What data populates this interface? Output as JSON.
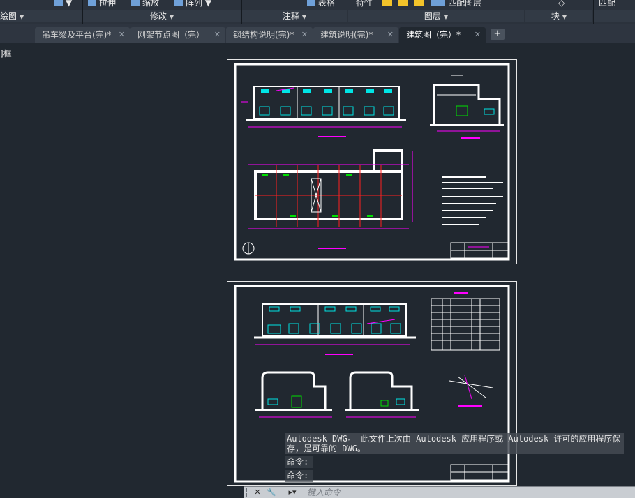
{
  "ribbon": {
    "top_items": [
      {
        "label": "▼",
        "icon": "dropdown-icon"
      },
      {
        "label": "拉伸",
        "icon": "stretch-icon"
      },
      {
        "label": "缩放",
        "icon": "scale-icon"
      },
      {
        "label": "阵列 ▼",
        "icon": "array-icon"
      },
      {
        "label": "表格",
        "icon": "table-icon"
      },
      {
        "label": "特性",
        "icon": "properties-icon"
      },
      {
        "label": "匹配图层",
        "icon": "match-layer-icon"
      },
      {
        "label": "匹配",
        "icon": "match-icon"
      }
    ],
    "panels": [
      {
        "label": "绘图"
      },
      {
        "label": "修改"
      },
      {
        "label": "注释"
      },
      {
        "label": "图层"
      },
      {
        "label": "块"
      }
    ]
  },
  "tabs": [
    {
      "label": "吊车梁及平台(完)*",
      "active": false
    },
    {
      "label": "刚架节点图（完）",
      "active": false
    },
    {
      "label": "钢结构说明(完)*",
      "active": false
    },
    {
      "label": "建筑说明(完)*",
      "active": false
    },
    {
      "label": "建筑图（完）*",
      "active": true
    }
  ],
  "add_tab_label": "+",
  "viewport_label": "]框",
  "command": {
    "message": "Autodesk DWG。 此文件上次由 Autodesk 应用程序或 Autodesk 许可的应用程序保存，是可靠的 DWG。",
    "history": [
      "命令:",
      "命令:"
    ],
    "placeholder": "键入命令"
  },
  "colors": {
    "background": "#212830",
    "accent_magenta": "#ff00ff",
    "accent_cyan": "#00e5e5",
    "accent_green": "#00e000",
    "accent_red": "#ff2020"
  }
}
